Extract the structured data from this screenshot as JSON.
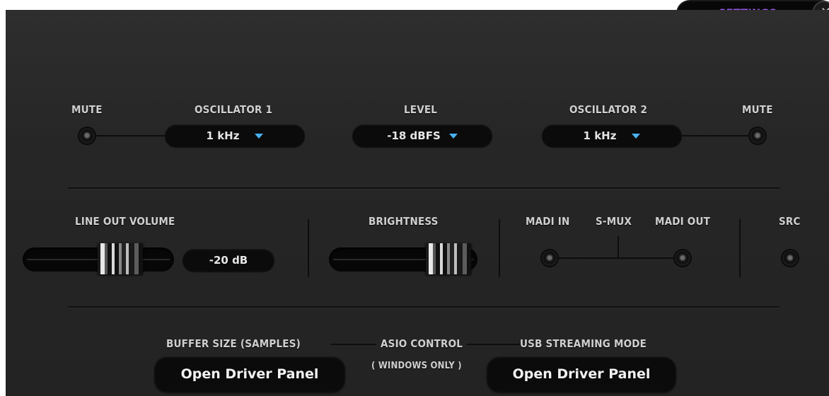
{
  "header": {
    "settings_label": "SETTINGS",
    "close_icon": "close-icon"
  },
  "oscillator_row": {
    "mute_left_label": "MUTE",
    "oscillator1_label": "OSCILLATOR 1",
    "oscillator1_value": "1 kHz",
    "level_label": "LEVEL",
    "level_value": "-18 dBFS",
    "oscillator2_label": "OSCILLATOR 2",
    "oscillator2_value": "1 kHz",
    "mute_right_label": "MUTE"
  },
  "controls_row": {
    "line_out_volume_label": "LINE OUT VOLUME",
    "line_out_volume_value": "-20 dB",
    "brightness_label": "BRIGHTNESS",
    "madi_in_label": "MADI IN",
    "smux_label": "S-MUX",
    "madi_out_label": "MADI OUT",
    "src_label": "SRC"
  },
  "driver_row": {
    "buffer_size_label": "BUFFER SIZE (SAMPLES)",
    "asio_control_label": "ASIO CONTROL",
    "windows_only_label": "( WINDOWS ONLY )",
    "usb_streaming_label": "USB STREAMING MODE",
    "open_driver_panel_left": "Open Driver Panel",
    "open_driver_panel_right": "Open Driver Panel"
  },
  "colors": {
    "accent_settings": "#9a56e8",
    "dropdown_caret": "#4ab2f2",
    "panel_bg": "#262626"
  }
}
